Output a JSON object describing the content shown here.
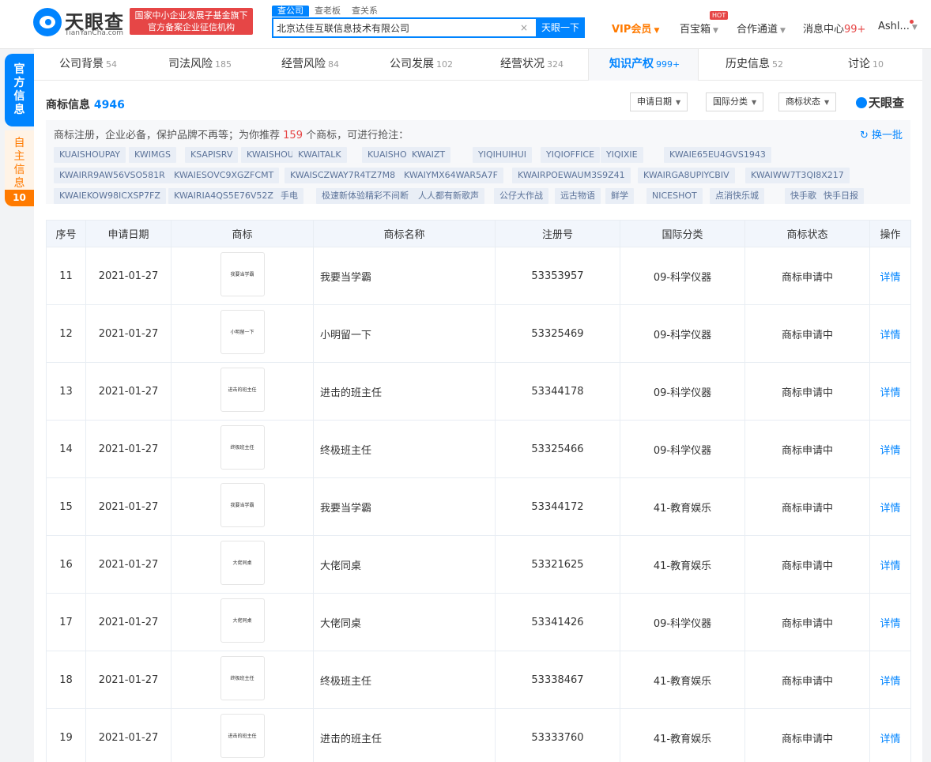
{
  "header": {
    "logo_cn": "天眼查",
    "logo_en": "TianYanCha.com",
    "slogan_line1": "国家中小企业发展子基金旗下",
    "slogan_line2": "官方备案企业征信机构",
    "search_tabs": [
      "查公司",
      "查老板",
      "查关系"
    ],
    "search_value": "北京达佳互联信息技术有限公司",
    "search_button": "天眼一下",
    "vip": "VIP会员",
    "baibaoxiang": "百宝箱",
    "hot": "HOT",
    "cooperation": "合作通道",
    "messages": "消息中心",
    "messages_count": "99+",
    "user": "Ashl..."
  },
  "sidebar": {
    "official": "官方信息",
    "self": "自主信息",
    "count": "10"
  },
  "tabs": [
    {
      "label": "公司背景",
      "count": "54"
    },
    {
      "label": "司法风险",
      "count": "185"
    },
    {
      "label": "经营风险",
      "count": "84"
    },
    {
      "label": "公司发展",
      "count": "102"
    },
    {
      "label": "经营状况",
      "count": "324"
    },
    {
      "label": "知识产权",
      "count": "999+"
    },
    {
      "label": "历史信息",
      "count": "52"
    },
    {
      "label": "讨论",
      "count": "10"
    }
  ],
  "section": {
    "title": "商标信息",
    "count": "4946",
    "filters": [
      "申请日期",
      "国际分类",
      "商标状态"
    ],
    "brand": "天眼查"
  },
  "recommend": {
    "text_before": "商标注册，企业必备，保护品牌不再等；为你推荐",
    "count": "159",
    "text_after": "个商标，可进行抢注：",
    "refresh": "换一批",
    "chips": [
      "KUAISHOUPAY",
      "KWIMGS",
      "KSAPISRV",
      "KWAISHOUAPP",
      "KWAITALK",
      "KUAISHOUZT",
      "KWAIZT",
      "YIQIHUIHUI",
      "YIQIOFFICE",
      "YIQIXIE",
      "KWAIE65EU4GVS1943",
      "KWAIRR9AW56VSO581R",
      "KWAIESOVC9XGZFCMT",
      "KWAISCZWAY7R4TZ7M8",
      "KWAIYMX64WAR5A7F",
      "KWAIRPOEWAUM3S9Z41",
      "KWAIRGA8UPIYCBIV",
      "KWAIWW7T3QI8X217",
      "KWAIEKOW98ICXSP7FZ",
      "KWAIRIA4QS5E76V52Z",
      "手电",
      "极速新体验精彩不间断",
      "人人都有新歌声",
      "公仔大作战",
      "远古物语",
      "鲜学",
      "NICESHOT",
      "点消快乐城",
      "快手歌",
      "快手日报"
    ]
  },
  "table": {
    "headers": [
      "序号",
      "申请日期",
      "商标",
      "商标名称",
      "注册号",
      "国际分类",
      "商标状态",
      "操作"
    ],
    "rows": [
      {
        "no": "11",
        "date": "2021-01-27",
        "mark": "我要当学霸",
        "name": "我要当学霸",
        "reg": "53353957",
        "cls": "09-科学仪器",
        "status": "商标申请中",
        "action": "详情"
      },
      {
        "no": "12",
        "date": "2021-01-27",
        "mark": "小明留一下",
        "name": "小明留一下",
        "reg": "53325469",
        "cls": "09-科学仪器",
        "status": "商标申请中",
        "action": "详情"
      },
      {
        "no": "13",
        "date": "2021-01-27",
        "mark": "进击的班主任",
        "name": "进击的班主任",
        "reg": "53344178",
        "cls": "09-科学仪器",
        "status": "商标申请中",
        "action": "详情"
      },
      {
        "no": "14",
        "date": "2021-01-27",
        "mark": "终极班主任",
        "name": "终极班主任",
        "reg": "53325466",
        "cls": "09-科学仪器",
        "status": "商标申请中",
        "action": "详情"
      },
      {
        "no": "15",
        "date": "2021-01-27",
        "mark": "我要当学霸",
        "name": "我要当学霸",
        "reg": "53344172",
        "cls": "41-教育娱乐",
        "status": "商标申请中",
        "action": "详情"
      },
      {
        "no": "16",
        "date": "2021-01-27",
        "mark": "大佬同桌",
        "name": "大佬同桌",
        "reg": "53321625",
        "cls": "41-教育娱乐",
        "status": "商标申请中",
        "action": "详情"
      },
      {
        "no": "17",
        "date": "2021-01-27",
        "mark": "大佬同桌",
        "name": "大佬同桌",
        "reg": "53341426",
        "cls": "09-科学仪器",
        "status": "商标申请中",
        "action": "详情"
      },
      {
        "no": "18",
        "date": "2021-01-27",
        "mark": "终极班主任",
        "name": "终极班主任",
        "reg": "53338467",
        "cls": "41-教育娱乐",
        "status": "商标申请中",
        "action": "详情"
      },
      {
        "no": "19",
        "date": "2021-01-27",
        "mark": "进击的班主任",
        "name": "进击的班主任",
        "reg": "53333760",
        "cls": "41-教育娱乐",
        "status": "商标申请中",
        "action": "详情"
      }
    ]
  }
}
